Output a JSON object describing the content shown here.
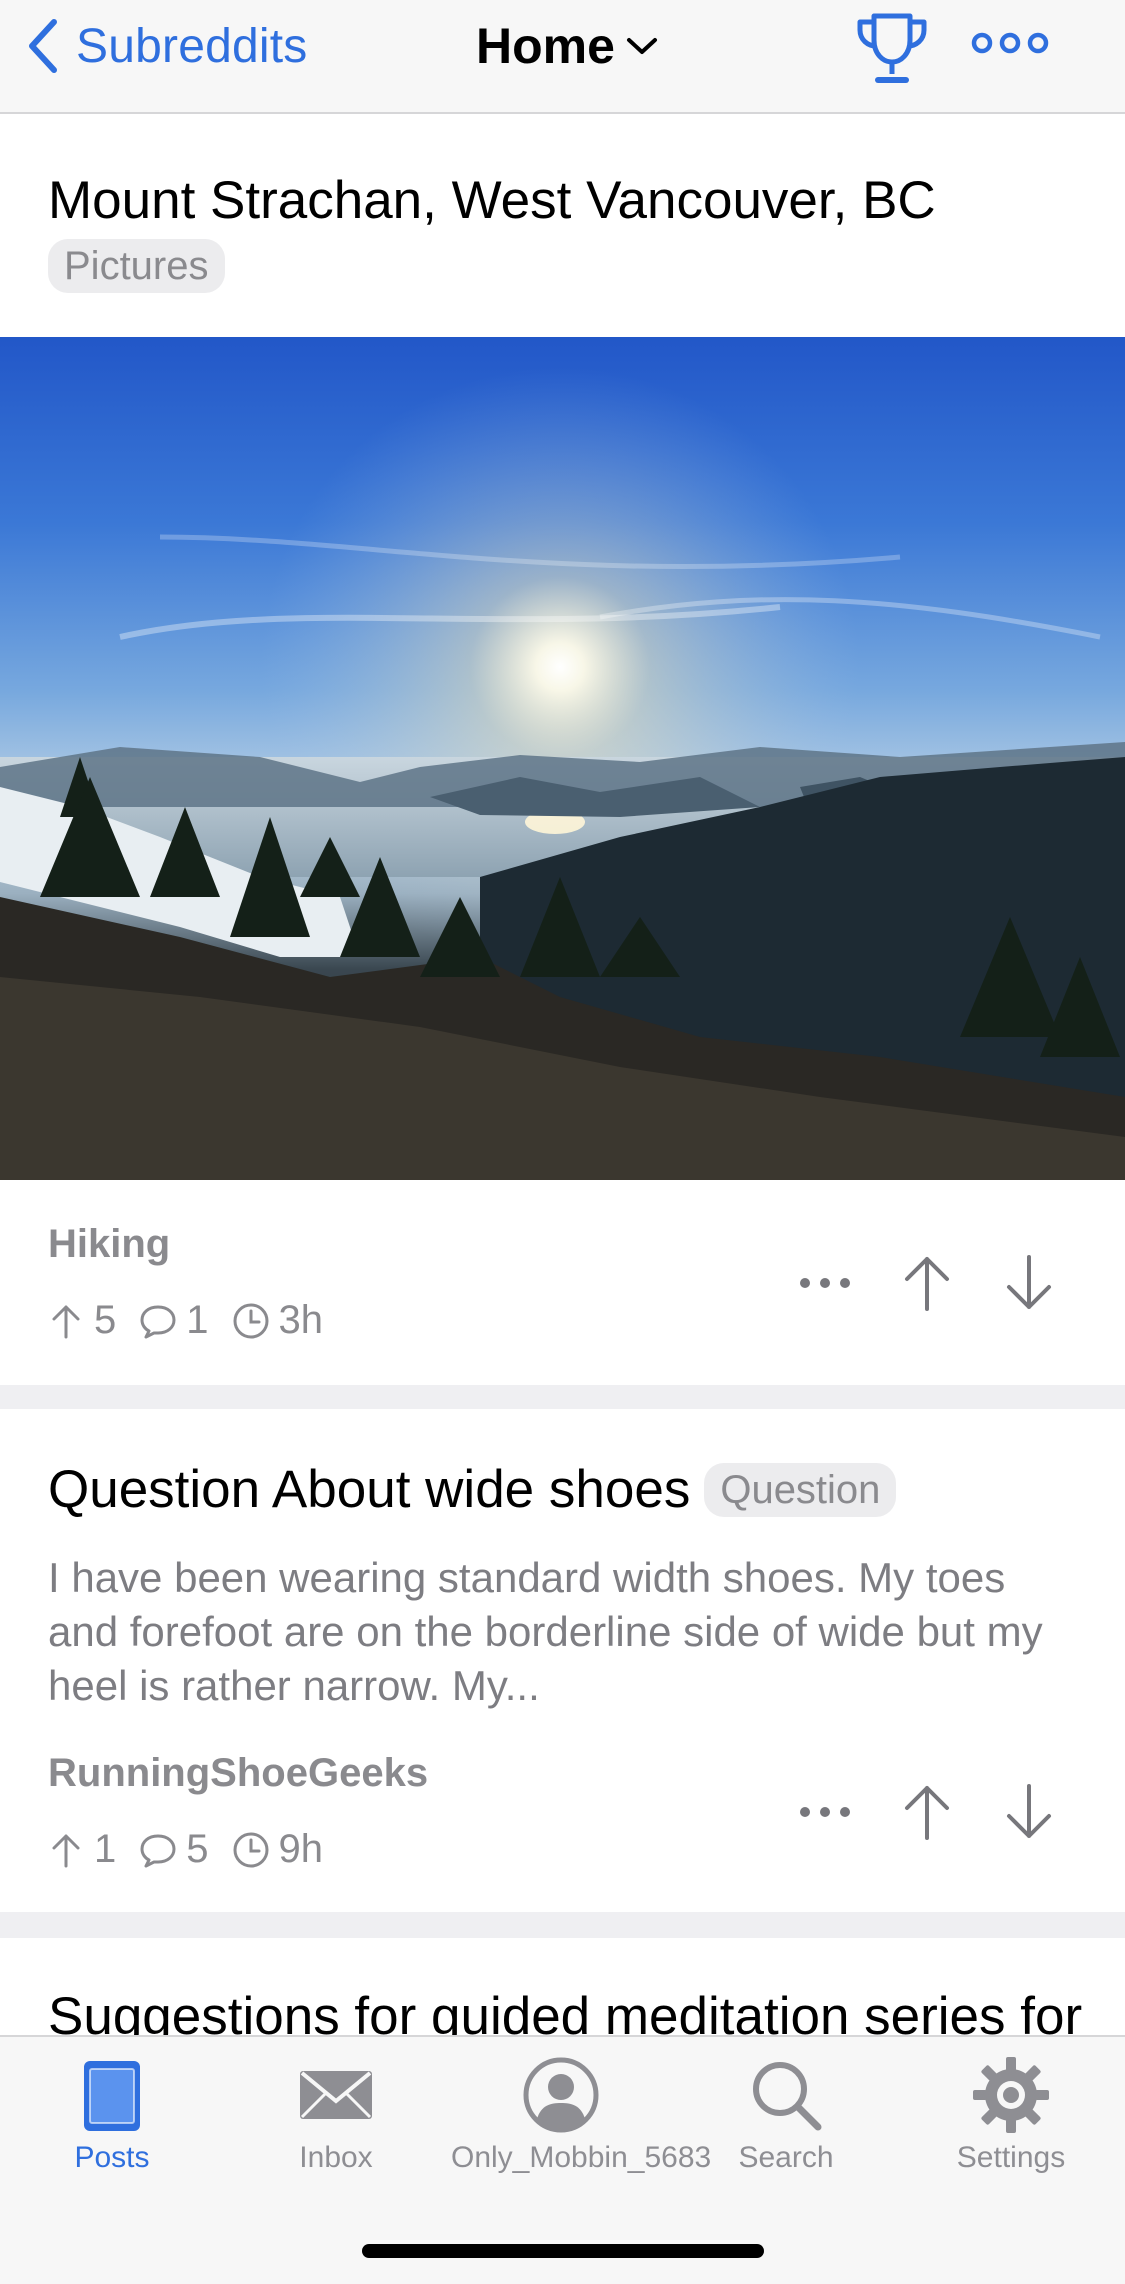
{
  "header": {
    "back_label": "Subreddits",
    "title": "Home"
  },
  "posts": [
    {
      "title": "Mount Strachan, West Vancouver, BC",
      "flair": "Pictures",
      "subreddit": "Hiking",
      "upvotes": "5",
      "comments": "1",
      "age": "3h"
    },
    {
      "title": "Question About wide shoes",
      "flair": "Question",
      "preview": "I have been wearing standard width shoes. My toes and forefoot are on the borderline side of wide but my heel is rather narrow. My...",
      "subreddit": "RunningShoeGeeks",
      "upvotes": "1",
      "comments": "5",
      "age": "9h"
    },
    {
      "title": "Suggestions for guided meditation series for"
    }
  ],
  "tabs": [
    {
      "label": "Posts",
      "icon": "posts-icon",
      "active": true
    },
    {
      "label": "Inbox",
      "icon": "inbox-icon"
    },
    {
      "label": "Only_Mobbin_5683",
      "icon": "profile-icon"
    },
    {
      "label": "Search",
      "icon": "search-icon"
    },
    {
      "label": "Settings",
      "icon": "gear-icon"
    }
  ],
  "colors": {
    "accent": "#2f6fde",
    "secondary_text": "#8a8a8e",
    "divider": "#efeff2"
  }
}
